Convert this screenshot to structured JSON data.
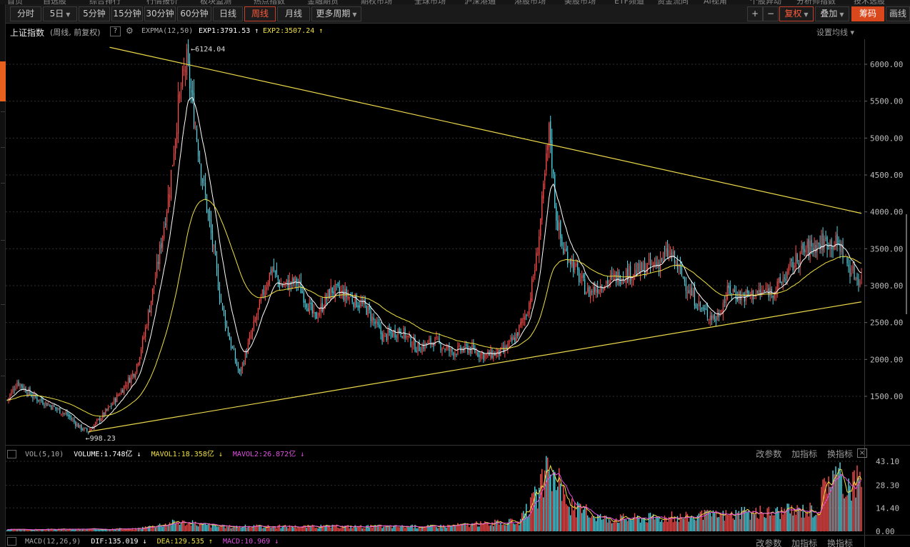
{
  "top_nav": [
    "首页",
    "自选股",
    "综合排行",
    "行情报价",
    "板块监测",
    "热点指数",
    "金融期货",
    "期权市场",
    "全球市场",
    "沪深港通",
    "港股市场",
    "美股市场",
    "ETF频道",
    "资金流向",
    "AI视角",
    "个股异动",
    "分析师指数",
    "技术选股"
  ],
  "toolbar": {
    "tabs": [
      {
        "label": "分时",
        "active": false,
        "dropdown": false
      },
      {
        "label": "5日",
        "active": false,
        "dropdown": true
      },
      {
        "label": "5分钟",
        "active": false,
        "dropdown": false
      },
      {
        "label": "15分钟",
        "active": false,
        "dropdown": false
      },
      {
        "label": "30分钟",
        "active": false,
        "dropdown": false
      },
      {
        "label": "60分钟",
        "active": false,
        "dropdown": false
      },
      {
        "label": "日线",
        "active": false,
        "dropdown": false
      },
      {
        "label": "周线",
        "active": true,
        "dropdown": false
      },
      {
        "label": "月线",
        "active": false,
        "dropdown": false
      },
      {
        "label": "更多周期",
        "active": false,
        "dropdown": true
      }
    ],
    "plus": "+",
    "minus": "−",
    "fuquan": "复权",
    "diejia": "叠加",
    "chouma": "筹码",
    "huaxian": "画线"
  },
  "info": {
    "title": "上证指数",
    "subtitle": "(周线, 前复权)",
    "help": "?",
    "indicator": "EXPMA(12,50)",
    "exp1": "EXP1:3791.53 ↑",
    "exp2": "EXP2:3507.24 ↑",
    "set_ma": "设置均线 ▾"
  },
  "colors": {
    "up": "#ff4d4d",
    "down": "#4fd8e8",
    "exp1": "#ffffff",
    "exp2": "#f0e040",
    "trend": "#ecd84a",
    "grid": "#2f2f2f",
    "mavol1": "#f0e040",
    "mavol2": "#e050e0"
  },
  "chart_data": {
    "type": "candlestick",
    "period": "weekly",
    "y_ticks": [
      "6000.00",
      "5500.00",
      "5000.00",
      "4500.00",
      "4000.00",
      "3500.00",
      "3000.00",
      "2500.00",
      "2000.00",
      "1500.00"
    ],
    "y_range": [
      998,
      6124
    ],
    "annotations": {
      "high": "6124.04",
      "low": "998.23"
    },
    "trend_lines": [
      {
        "from": [
          0.12,
          6230
        ],
        "to": [
          1.0,
          3980
        ]
      },
      {
        "from": [
          0.095,
          1020
        ],
        "to": [
          1.0,
          2780
        ]
      }
    ],
    "close_path": [
      [
        0,
        1450
      ],
      [
        0.012,
        1700
      ],
      [
        0.03,
        1500
      ],
      [
        0.05,
        1380
      ],
      [
        0.07,
        1250
      ],
      [
        0.085,
        1080
      ],
      [
        0.095,
        1020
      ],
      [
        0.105,
        1150
      ],
      [
        0.12,
        1350
      ],
      [
        0.135,
        1600
      ],
      [
        0.15,
        1850
      ],
      [
        0.16,
        2300
      ],
      [
        0.175,
        3200
      ],
      [
        0.19,
        4300
      ],
      [
        0.2,
        5400
      ],
      [
        0.21,
        6050
      ],
      [
        0.22,
        5200
      ],
      [
        0.228,
        4500
      ],
      [
        0.24,
        3600
      ],
      [
        0.25,
        2800
      ],
      [
        0.262,
        2200
      ],
      [
        0.272,
        1800
      ],
      [
        0.285,
        2300
      ],
      [
        0.3,
        2900
      ],
      [
        0.31,
        3250
      ],
      [
        0.32,
        3000
      ],
      [
        0.34,
        3050
      ],
      [
        0.36,
        2550
      ],
      [
        0.38,
        2950
      ],
      [
        0.4,
        2850
      ],
      [
        0.42,
        2700
      ],
      [
        0.44,
        2300
      ],
      [
        0.46,
        2400
      ],
      [
        0.48,
        2150
      ],
      [
        0.5,
        2250
      ],
      [
        0.52,
        2100
      ],
      [
        0.54,
        2150
      ],
      [
        0.56,
        2050
      ],
      [
        0.58,
        2100
      ],
      [
        0.595,
        2300
      ],
      [
        0.61,
        2700
      ],
      [
        0.62,
        3400
      ],
      [
        0.628,
        4300
      ],
      [
        0.635,
        5150
      ],
      [
        0.642,
        4000
      ],
      [
        0.65,
        3500
      ],
      [
        0.66,
        3350
      ],
      [
        0.67,
        3100
      ],
      [
        0.68,
        2900
      ],
      [
        0.7,
        3050
      ],
      [
        0.72,
        3150
      ],
      [
        0.74,
        3200
      ],
      [
        0.76,
        3300
      ],
      [
        0.775,
        3450
      ],
      [
        0.785,
        3250
      ],
      [
        0.8,
        2900
      ],
      [
        0.815,
        2650
      ],
      [
        0.83,
        2550
      ],
      [
        0.845,
        2950
      ],
      [
        0.86,
        2850
      ],
      [
        0.88,
        2900
      ],
      [
        0.9,
        2950
      ],
      [
        0.915,
        3200
      ],
      [
        0.93,
        3450
      ],
      [
        0.945,
        3550
      ],
      [
        0.96,
        3600
      ],
      [
        0.975,
        3550
      ],
      [
        0.985,
        3250
      ],
      [
        0.995,
        3100
      ]
    ],
    "volume": {
      "ticks": [
        "43.10",
        "28.30",
        "14.40",
        "0.00"
      ],
      "max": 43.1
    }
  },
  "volume_panel": {
    "name": "VOL(5,10)",
    "volume": "VOLUME:1.748亿 ↓",
    "mavol1": "MAVOL1:18.358亿 ↓",
    "mavol2": "MAVOL2:26.872亿 ↓",
    "params": "改参数",
    "add": "加指标",
    "switch": "换指标",
    "close": "×"
  },
  "macd_panel": {
    "name": "MACD(12,26,9)",
    "dif": "DIF:135.019 ↓",
    "dea": "DEA:129.535 ↑",
    "macd": "MACD:10.969 ↓",
    "params": "改参数",
    "add": "加指标",
    "switch": "换指标"
  }
}
